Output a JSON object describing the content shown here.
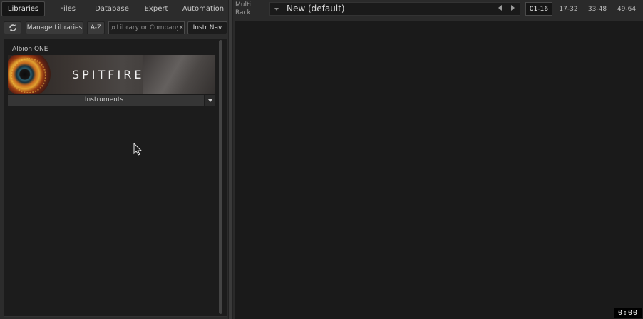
{
  "browser": {
    "tabs": [
      {
        "label": "Libraries",
        "active": true
      },
      {
        "label": "Files",
        "active": false
      },
      {
        "label": "Database",
        "active": false
      },
      {
        "label": "Expert",
        "active": false
      },
      {
        "label": "Automation",
        "active": false
      }
    ],
    "toolbar": {
      "refresh_icon": "refresh-icon",
      "manage_label": "Manage Libraries",
      "az_label": "A-Z",
      "search_placeholder": "Library or Company",
      "search_value": "",
      "clear_glyph": "×",
      "instr_nav_label": "Instr Nav"
    },
    "library": {
      "title": "Albion ONE",
      "brand": "SPITFIRE",
      "dropdown_label": "Instruments"
    }
  },
  "rack": {
    "label_line1": "Multi",
    "label_line2": "Rack",
    "preset_name": "New (default)",
    "pages": [
      {
        "label": "01-16",
        "active": true
      },
      {
        "label": "17-32",
        "active": false
      },
      {
        "label": "33-48",
        "active": false
      },
      {
        "label": "49-64",
        "active": false
      }
    ]
  },
  "timer": "0:00",
  "colors": {
    "panel_bg": "#2c2c2c",
    "rack_bg": "#1a1a1a",
    "active_tab_bg": "#161616"
  }
}
